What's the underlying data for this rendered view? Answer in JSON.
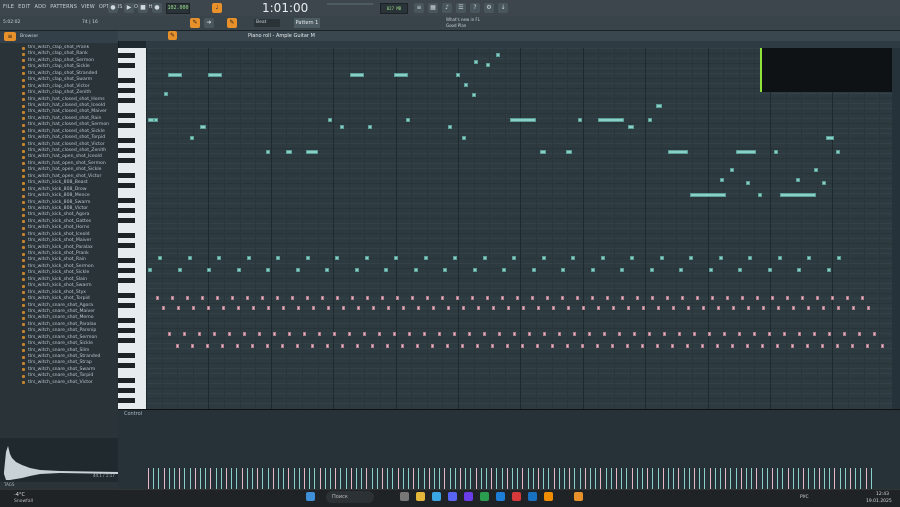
{
  "menu": [
    "FILE",
    "EDIT",
    "ADD",
    "PATTERNS",
    "VIEW",
    "OPTIONS",
    "TOOLS",
    "HELP"
  ],
  "transport": {
    "tempo": "102.000",
    "time": "1:01:00",
    "time_small": "00",
    "hint": "Move mouse to reveal menu",
    "pattern": "Pattern 1",
    "snap": "Beat",
    "cpu_left": "5:02:02",
    "ratio": "74 | 16",
    "mem": "827 MB",
    "mem2": "16",
    "what_new": "What's new in FL",
    "news": "Good Plan"
  },
  "browser": {
    "title": "Browser",
    "items": [
      "tlrs_witch_clap_shot_Prank",
      "tlrs_witch_clap_shot_Rank",
      "tlrs_witch_clap_shot_Sermon",
      "tlrs_witch_clap_shot_Sickle",
      "tlrs_witch_clap_shot_Stranded",
      "tlrs_witch_clap_shot_Swarm",
      "tlrs_witch_clap_shot_Victor",
      "tlrs_witch_clap_shot_Zenith",
      "tlrs_witch_hat_closed_shot_Horns",
      "tlrs_witch_hat_closed_shot_Iceold",
      "tlrs_witch_hat_closed_shot_Maiver",
      "tlrs_witch_hat_closed_shot_Rain",
      "tlrs_witch_hat_closed_shot_Sermon",
      "tlrs_witch_hat_closed_shot_Sickle",
      "tlrs_witch_hat_closed_shot_Torpid",
      "tlrs_witch_hat_closed_shot_Victor",
      "tlrs_witch_hat_closed_shot_Zenith",
      "tlrs_witch_hat_open_shot_Iceold",
      "tlrs_witch_hat_open_shot_Sermon",
      "tlrs_witch_hat_open_shot_Sickle",
      "tlrs_witch_hat_open_shot_Victor",
      "tlrs_witch_kick_808_Beast",
      "tlrs_witch_kick_808_Drow",
      "tlrs_witch_kick_808_Mence",
      "tlrs_witch_kick_808_Swarm",
      "tlrs_witch_kick_808_Victor",
      "tlrs_witch_kick_shot_Agora",
      "tlrs_witch_kick_shot_Gattes",
      "tlrs_witch_kick_shot_Horns",
      "tlrs_witch_kick_shot_Iceold",
      "tlrs_witch_kick_shot_Maiver",
      "tlrs_witch_kick_shot_Paralax",
      "tlrs_witch_kick_shot_Prank",
      "tlrs_witch_kick_shot_Rain",
      "tlrs_witch_kick_shot_Sermon",
      "tlrs_witch_kick_shot_Sickle",
      "tlrs_witch_kick_shot_Slain",
      "tlrs_witch_kick_shot_Swarm",
      "tlrs_witch_kick_shot_Styx",
      "tlrs_witch_kick_shot_Torpid",
      "tlrs_witch_snare_shot_Agora",
      "tlrs_witch_snare_shot_Maiver",
      "tlrs_witch_snare_shot_Memo",
      "tlrs_witch_snare_shot_Paralax",
      "tlrs_witch_snare_shot_Parsnip",
      "tlrs_witch_snare_shot_Sermon",
      "tlrs_witch_snare_shot_Sickle",
      "tlrs_witch_snare_shot_Slim",
      "tlrs_witch_snare_shot_Stranded",
      "tlrs_witch_snare_shot_Strap",
      "tlrs_witch_snare_shot_Swarm",
      "tlrs_witch_snare_shot_Torpid",
      "tlrs_witch_snare_shot_Victor"
    ],
    "tags_label": "TAGS",
    "sample_info": "44.1 / 1:17"
  },
  "piano_roll": {
    "title": "Piano roll - Ample Guitar M",
    "control_label": "Control",
    "channel": "Beat"
  },
  "taskbar": {
    "weather_temp": "-4°C",
    "weather_text": "Snowfall",
    "search": "Поиск",
    "lang": "РУС",
    "clock": "12:43",
    "date": "19.01.2025"
  },
  "colors": {
    "accent": "#e8912a",
    "note": "#8ad0c8",
    "note_pink": "#e8b7c6",
    "grid": "#2d3a40"
  }
}
